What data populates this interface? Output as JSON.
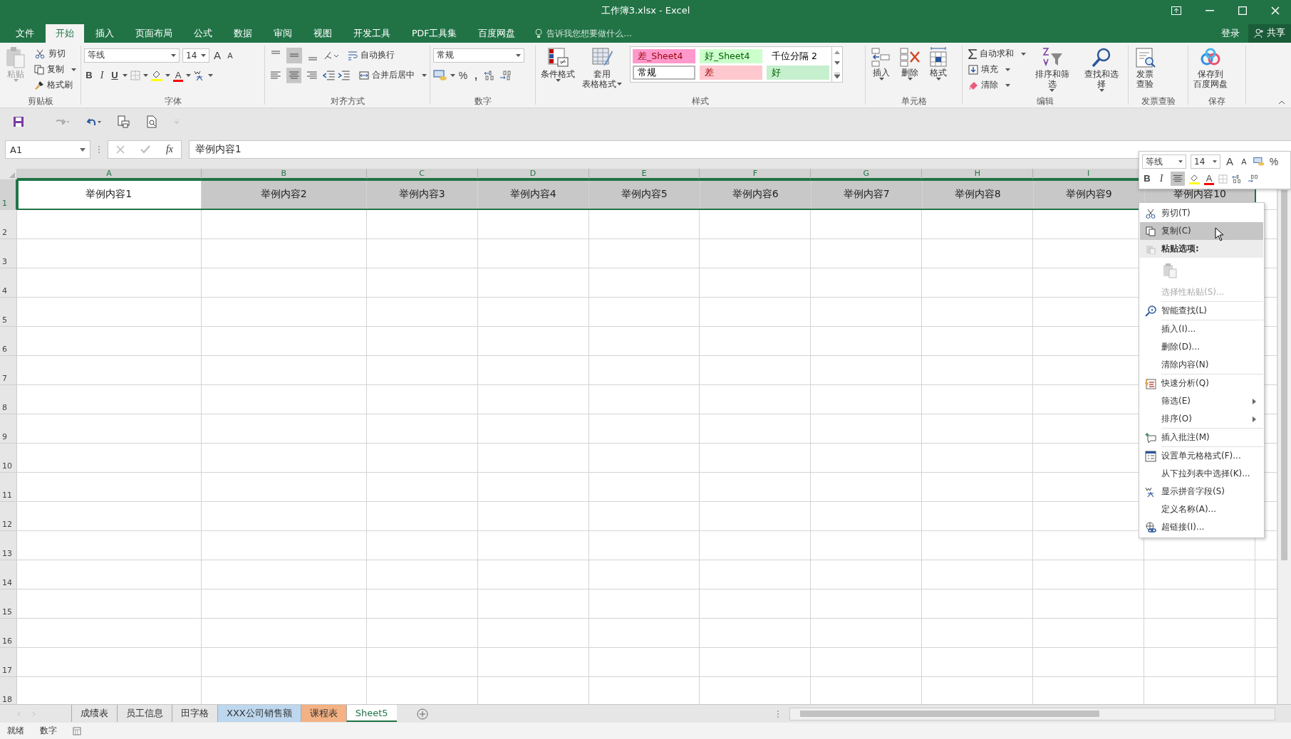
{
  "window": {
    "title": "工作簿3.xlsx - Excel"
  },
  "ribbon_tabs": [
    {
      "label": "文件",
      "selected": false
    },
    {
      "label": "开始",
      "selected": true
    },
    {
      "label": "插入",
      "selected": false
    },
    {
      "label": "页面布局",
      "selected": false
    },
    {
      "label": "公式",
      "selected": false
    },
    {
      "label": "数据",
      "selected": false
    },
    {
      "label": "审阅",
      "selected": false
    },
    {
      "label": "视图",
      "selected": false
    },
    {
      "label": "开发工具",
      "selected": false
    },
    {
      "label": "PDF工具集",
      "selected": false
    },
    {
      "label": "百度网盘",
      "selected": false
    }
  ],
  "tell_me": {
    "placeholder": "告诉我您想要做什么..."
  },
  "account": {
    "sign_in": "登录",
    "share": "共享"
  },
  "clipboard": {
    "paste": "粘贴",
    "cut": "剪切",
    "copy": "复制",
    "format_painter": "格式刷",
    "label": "剪贴板"
  },
  "font": {
    "name": "等线",
    "size": "14",
    "grow": "A",
    "shrink": "A",
    "bold": "B",
    "italic": "I",
    "underline": "U",
    "font_color_button": "A",
    "label": "字体"
  },
  "alignment": {
    "vertical_buttons": [
      {
        "selected": false
      },
      {
        "selected": true
      },
      {
        "selected": false
      }
    ],
    "horizontal_buttons": [
      {
        "selected": false
      },
      {
        "selected": true
      },
      {
        "selected": false
      }
    ],
    "wrap": "自动换行",
    "merge": "合并后居中",
    "label": "对齐方式"
  },
  "number": {
    "format": "常规",
    "percent": "%",
    "comma": ",",
    "label": "数字"
  },
  "styles": {
    "conditional": "条件格式",
    "table": [
      "套用",
      "表格格式"
    ],
    "label": "样式",
    "cells": [
      {
        "label": "差_Sheet4",
        "color": "#ff99cc",
        "kind": "bad",
        "selected": false
      },
      {
        "label": "好_Sheet4",
        "color": "#ccffcc",
        "kind": "good",
        "selected": false
      },
      {
        "label": "千位分隔 2",
        "color": "#ffffff",
        "kind": "neutral",
        "selected": false
      },
      {
        "label": "常规",
        "color": "#ffffff",
        "kind": "neutral",
        "selected": true
      },
      {
        "label": "差",
        "color": "#ffc7ce",
        "kind": "bad",
        "selected": false
      },
      {
        "label": "好",
        "color": "#c6efce",
        "kind": "good",
        "selected": false
      }
    ]
  },
  "cells": {
    "insert": "插入",
    "delete": "删除",
    "format": "格式",
    "label": "单元格"
  },
  "editing": {
    "autosum": "自动求和",
    "fill": "填充",
    "clear": "清除",
    "sort": "排序和筛选",
    "find": "查找和选择",
    "label": "编辑"
  },
  "invoice": {
    "button": [
      "发票",
      "查验"
    ],
    "label": "发票查验"
  },
  "save_cloud": {
    "button": [
      "保存到",
      "百度网盘"
    ],
    "label": "保存"
  },
  "formula_bar": {
    "name_box": "A1",
    "function_label": "fx",
    "value": "举例内容1"
  },
  "columns": [
    "A",
    "B",
    "C",
    "D",
    "E",
    "F",
    "G",
    "H",
    "I"
  ],
  "row_headers": [
    "1",
    "2",
    "3",
    "4",
    "5",
    "6",
    "7",
    "8",
    "9",
    "10",
    "11",
    "12",
    "13",
    "14",
    "15",
    "16",
    "17",
    "18"
  ],
  "row1": [
    {
      "text": "举例内容1",
      "shaded": false
    },
    {
      "text": "举例内容2",
      "shaded": true
    },
    {
      "text": "举例内容3",
      "shaded": true
    },
    {
      "text": "举例内容4",
      "shaded": true
    },
    {
      "text": "举例内容5",
      "shaded": true
    },
    {
      "text": "举例内容6",
      "shaded": true
    },
    {
      "text": "举例内容7",
      "shaded": true
    },
    {
      "text": "举例内容8",
      "shaded": true
    },
    {
      "text": "举例内容9",
      "shaded": true
    },
    {
      "text": "举例内容10",
      "shaded": true
    }
  ],
  "sheet_tabs": [
    {
      "label": "成绩表",
      "selected": false
    },
    {
      "label": "员工信息",
      "selected": false
    },
    {
      "label": "田字格",
      "selected": false
    },
    {
      "label": "XXX公司销售额",
      "selected": false,
      "color": "#bdd7ee"
    },
    {
      "label": "课程表",
      "selected": false,
      "color": "#f4b183"
    },
    {
      "label": "Sheet5",
      "selected": true
    }
  ],
  "status_bar": {
    "ready": "就绪",
    "mode": "数字"
  },
  "mini_toolbar": {
    "font": "等线",
    "size": "14",
    "grow": "A",
    "shrink": "A",
    "bold": "B",
    "italic": "I",
    "font_color_button": "A",
    "percent": "%"
  },
  "context_menu": {
    "sections": [
      [
        {
          "label": "剪切(T)",
          "kind": "cut",
          "selected": false,
          "disabled": false
        },
        {
          "label": "复制(C)",
          "kind": "copy",
          "selected": true,
          "disabled": false
        },
        {
          "label": "粘贴选项:",
          "kind": "paste-header",
          "selected": false,
          "disabled": false
        },
        {
          "kind": "paste-option",
          "selected": false,
          "disabled": false
        },
        {
          "label": "选择性粘贴(S)...",
          "kind": "plain",
          "selected": false,
          "disabled": true
        }
      ],
      [
        {
          "label": "智能查找(L)",
          "kind": "lookup",
          "selected": false,
          "disabled": false
        }
      ],
      [
        {
          "label": "插入(I)...",
          "kind": "plain",
          "selected": false,
          "disabled": false
        },
        {
          "label": "删除(D)...",
          "kind": "plain",
          "selected": false,
          "disabled": false
        },
        {
          "label": "清除内容(N)",
          "kind": "plain",
          "selected": false,
          "disabled": false
        }
      ],
      [
        {
          "label": "快速分析(Q)",
          "kind": "quick-analysis",
          "selected": false,
          "disabled": false
        },
        {
          "label": "筛选(E)",
          "kind": "submenu",
          "selected": false,
          "disabled": false
        },
        {
          "label": "排序(O)",
          "kind": "submenu",
          "selected": false,
          "disabled": false
        }
      ],
      [
        {
          "label": "插入批注(M)",
          "kind": "comment",
          "selected": false,
          "disabled": false
        }
      ],
      [
        {
          "label": "设置单元格格式(F)...",
          "kind": "format-cells",
          "selected": false,
          "disabled": false
        },
        {
          "label": "从下拉列表中选择(K)...",
          "kind": "plain",
          "selected": false,
          "disabled": false
        },
        {
          "label": "显示拼音字段(S)",
          "kind": "phonetic",
          "selected": false,
          "disabled": false
        },
        {
          "label": "定义名称(A)...",
          "kind": "plain",
          "selected": false,
          "disabled": false
        },
        {
          "label": "超链接(I)...",
          "kind": "hyperlink",
          "selected": false,
          "disabled": false
        }
      ]
    ]
  }
}
